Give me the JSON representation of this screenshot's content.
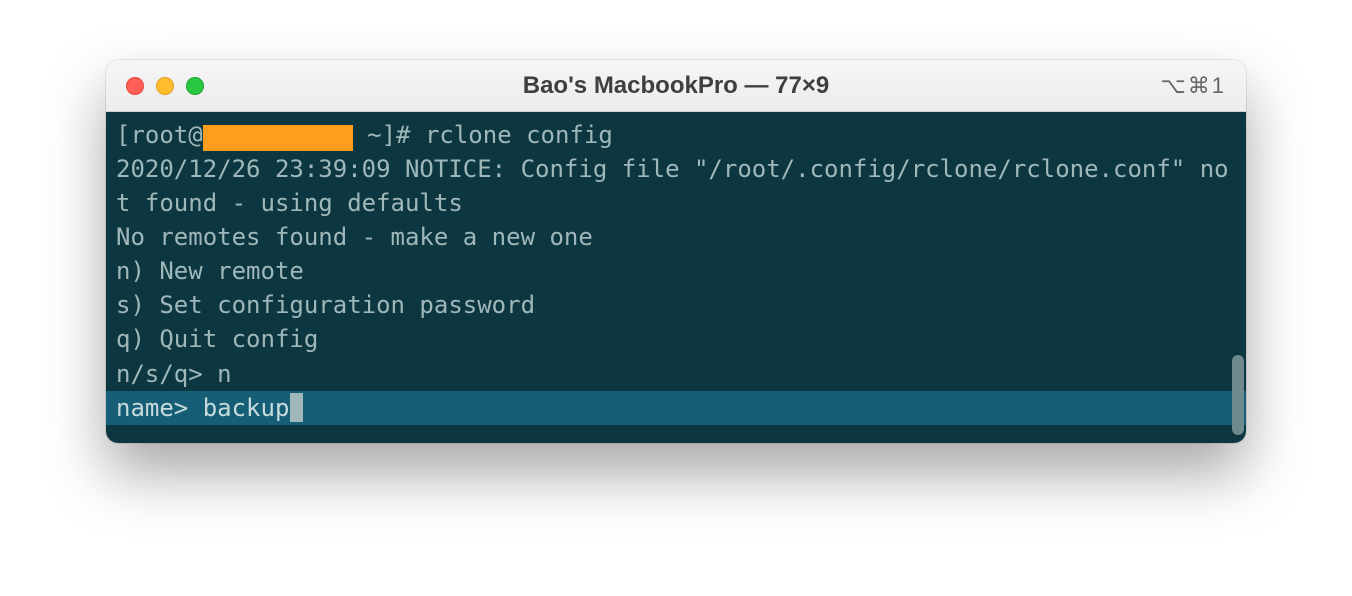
{
  "window": {
    "title": "Bao's MacbookPro — 77×9",
    "shortcut": "⌥⌘1"
  },
  "terminal": {
    "prompt_prefix": "[root@",
    "prompt_suffix": " ~]# ",
    "command": "rclone config",
    "lines": {
      "notice": "2020/12/26 23:39:09 NOTICE: Config file \"/root/.config/rclone/rclone.conf\" not found - using defaults",
      "no_remotes": "No remotes found - make a new one",
      "opt_n": "n) New remote",
      "opt_s": "s) Set configuration password",
      "opt_q": "q) Quit config",
      "choice_prompt": "n/s/q> ",
      "choice_input": "n",
      "name_prompt": "name> ",
      "name_input": "backup"
    }
  }
}
